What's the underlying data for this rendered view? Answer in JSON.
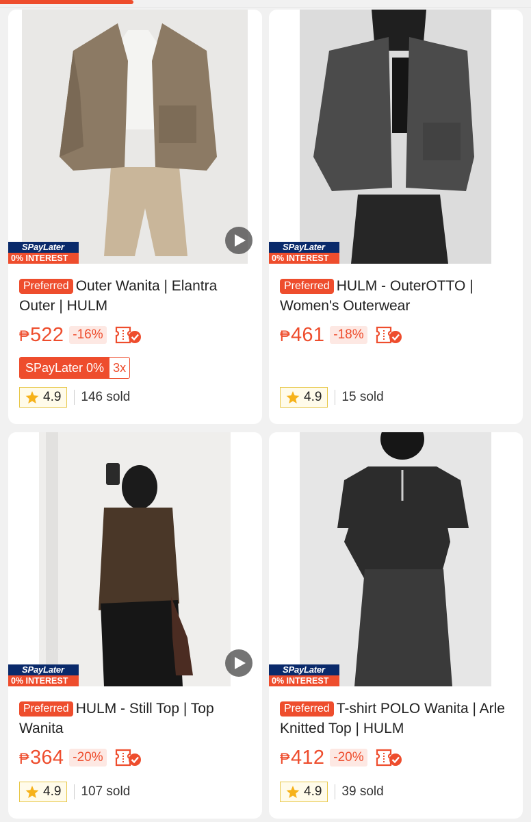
{
  "colors": {
    "accent": "#ee4d2d",
    "spaylater_navy": "#0a2a6b",
    "rating_border": "#e8c84a"
  },
  "products": [
    {
      "badge_top": "SPayLater",
      "badge_bottom": "0% INTEREST",
      "has_video": true,
      "preferred": "Preferred",
      "title": "Outer Wanita | Elantra Outer | HULM",
      "currency": "₱",
      "price": "522",
      "discount": "-16%",
      "spaylater_tag": "SPayLater 0%",
      "spaylater_installments": "3x",
      "rating": "4.9",
      "sold": "146 sold"
    },
    {
      "badge_top": "SPayLater",
      "badge_bottom": "0% INTEREST",
      "has_video": false,
      "preferred": "Preferred",
      "title": "HULM - OuterOTTO | Women's Outerwear",
      "currency": "₱",
      "price": "461",
      "discount": "-18%",
      "rating": "4.9",
      "sold": "15 sold"
    },
    {
      "badge_top": "SPayLater",
      "badge_bottom": "0% INTEREST",
      "has_video": true,
      "preferred": "Preferred",
      "title": "HULM - Still Top | Top Wanita",
      "currency": "₱",
      "price": "364",
      "discount": "-20%",
      "rating": "4.9",
      "sold": "107 sold"
    },
    {
      "badge_top": "SPayLater",
      "badge_bottom": "0% INTEREST",
      "has_video": false,
      "preferred": "Preferred",
      "title": "T-shirt POLO Wanita | Arle Knitted Top | HULM",
      "currency": "₱",
      "price": "412",
      "discount": "-20%",
      "rating": "4.9",
      "sold": "39 sold"
    }
  ]
}
